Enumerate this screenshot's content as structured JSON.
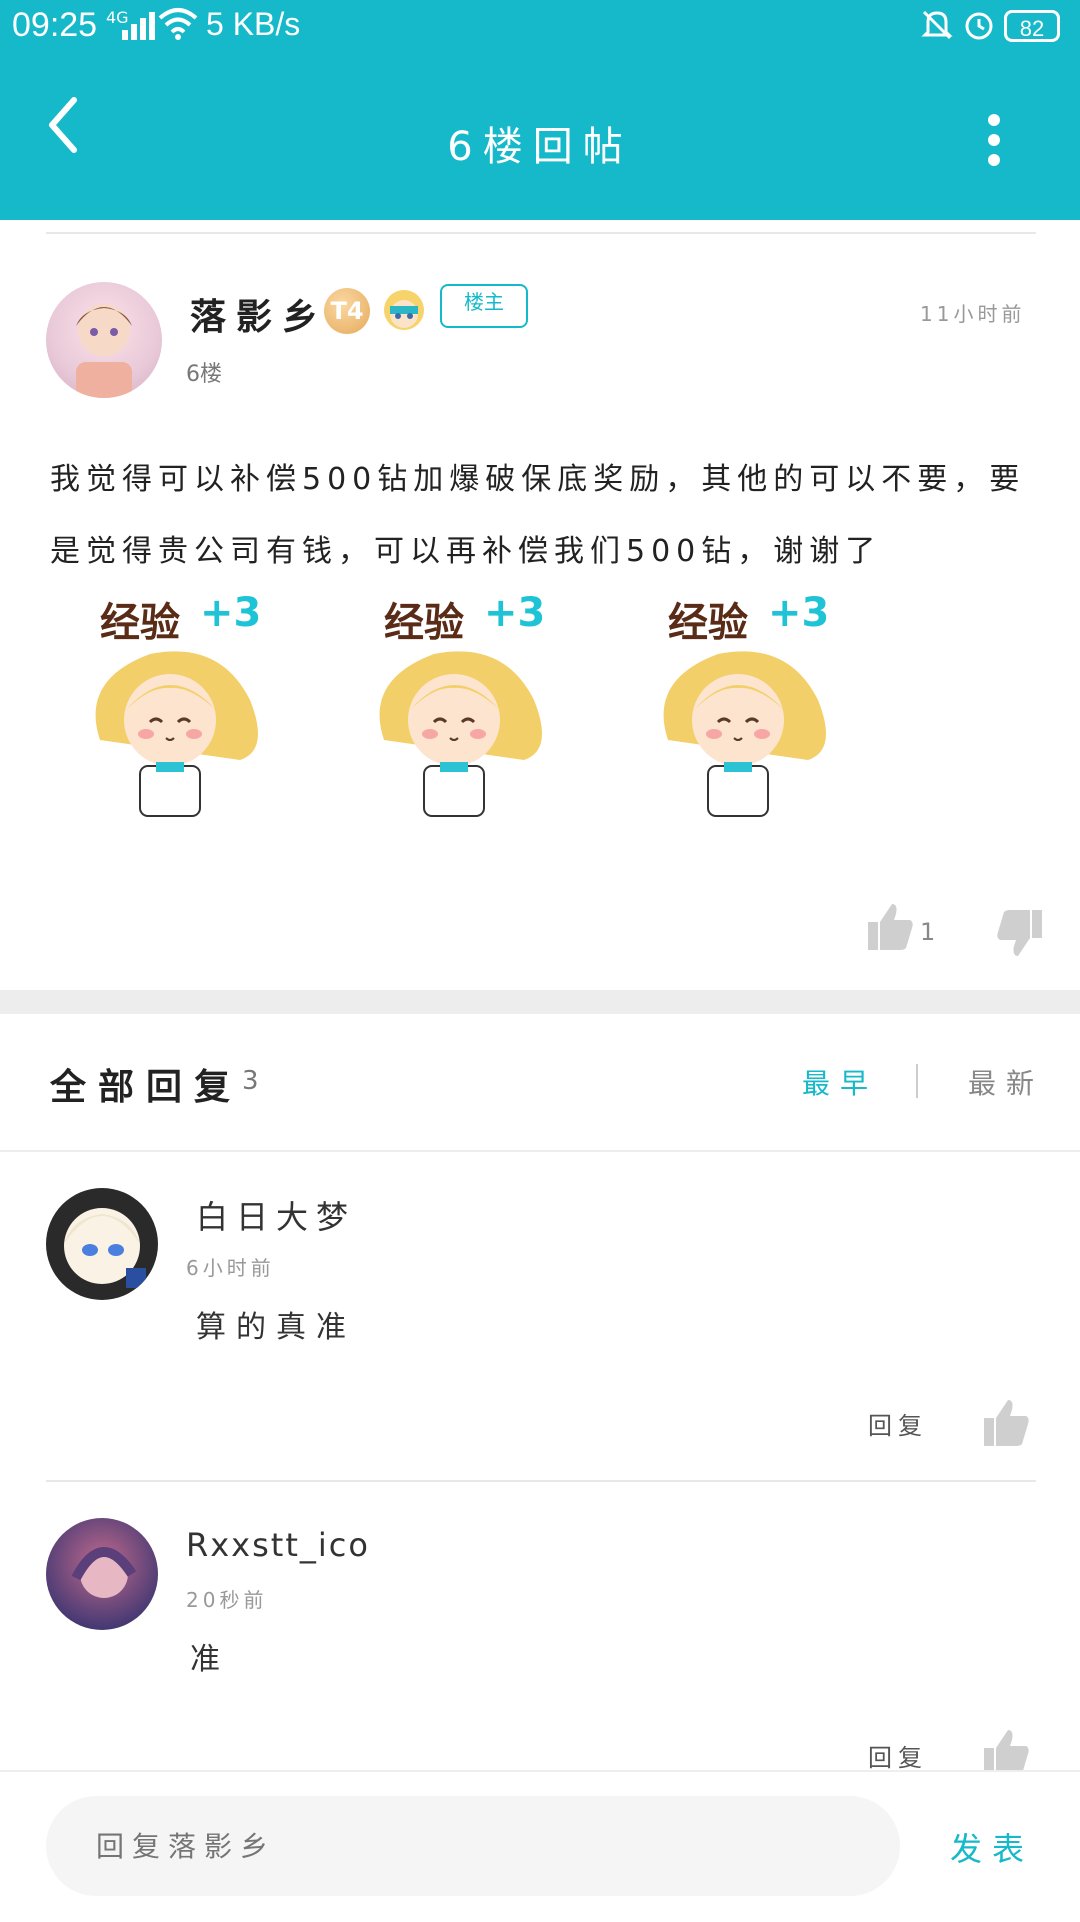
{
  "status_bar": {
    "time": "09:25",
    "network": "4G",
    "speed": "5 KB/s",
    "battery": "82"
  },
  "header": {
    "title": "6楼回帖"
  },
  "post": {
    "author": "落影乡",
    "level_badge": "T4",
    "owner_badge": "楼主",
    "time": "11小时前",
    "floor": "6楼",
    "text": "我觉得可以补偿500钻加爆破保底奖励，其他的可以不要，要是觉得贵公司有钱，可以再补偿我们500钻，谢谢了",
    "stickers": [
      {
        "label": "经验",
        "plus": "+3"
      },
      {
        "label": "经验",
        "plus": "+3"
      },
      {
        "label": "经验",
        "plus": "+3"
      }
    ],
    "like_count": "1"
  },
  "replies_section": {
    "title": "全部回复",
    "count": "3",
    "sort_earliest": "最早",
    "sort_latest": "最新"
  },
  "replies": [
    {
      "name": "白日大梦",
      "time": "6小时前",
      "text": "算的真准",
      "action": "回复"
    },
    {
      "name": "Rxxstt_ico",
      "time": "20秒前",
      "text": "准",
      "action": "回复"
    }
  ],
  "bottom_bar": {
    "placeholder": "回复落影乡",
    "publish": "发表"
  },
  "colors": {
    "accent": "#16b9c9"
  }
}
